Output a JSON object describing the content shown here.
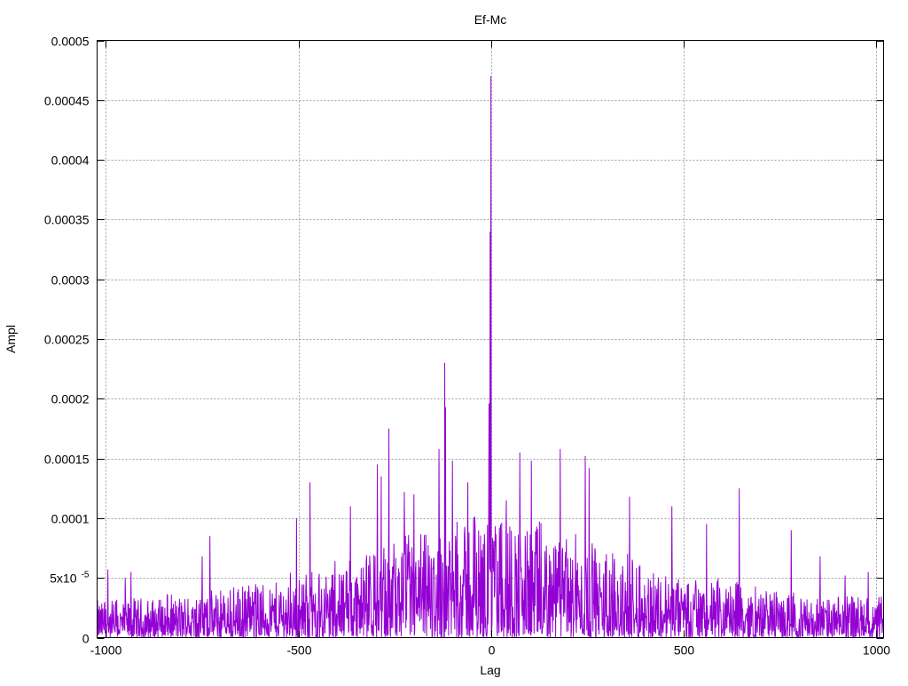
{
  "chart_data": {
    "type": "line",
    "title": "Ef-Mc",
    "xlabel": "Lag",
    "ylabel": "Ampl",
    "xlim": [
      -1023,
      1020
    ],
    "ylim": [
      0,
      0.0005
    ],
    "grid": true,
    "line_color": "#9400d3",
    "x_ticks": [
      {
        "value": -1000,
        "label": "-1000"
      },
      {
        "value": -500,
        "label": "-500"
      },
      {
        "value": 0,
        "label": "0"
      },
      {
        "value": 500,
        "label": "500"
      },
      {
        "value": 1000,
        "label": "1000"
      }
    ],
    "y_ticks": [
      {
        "value": 0,
        "label": "0"
      },
      {
        "value": 5e-05,
        "label": "5x10",
        "sup": "-5"
      },
      {
        "value": 0.0001,
        "label": "0.0001"
      },
      {
        "value": 0.00015,
        "label": "0.00015"
      },
      {
        "value": 0.0002,
        "label": "0.0002"
      },
      {
        "value": 0.00025,
        "label": "0.00025"
      },
      {
        "value": 0.0003,
        "label": "0.0003"
      },
      {
        "value": 0.00035,
        "label": "0.00035"
      },
      {
        "value": 0.0004,
        "label": "0.0004"
      },
      {
        "value": 0.00045,
        "label": "0.00045"
      },
      {
        "value": 0.0005,
        "label": "0.0005"
      }
    ],
    "series": [
      {
        "name": "Ef-Mc",
        "envelope": {
          "center_max": 0.000105,
          "edge_max": 3e-05
        },
        "peaks": [
          [
            0,
            0.00047
          ],
          [
            -2,
            0.00034
          ],
          [
            -5,
            0.000196
          ],
          [
            -120,
            0.00023
          ],
          [
            -118,
            0.000193
          ],
          [
            -265,
            0.000175
          ],
          [
            -135,
            0.000158
          ],
          [
            -295,
            0.000145
          ],
          [
            -470,
            0.00013
          ],
          [
            -285,
            0.000135
          ],
          [
            -225,
            0.000122
          ],
          [
            75,
            0.000155
          ],
          [
            105,
            0.000148
          ],
          [
            180,
            0.000158
          ],
          [
            245,
            0.000152
          ],
          [
            255,
            0.000142
          ],
          [
            645,
            0.000125
          ],
          [
            -100,
            0.000148
          ],
          [
            -60,
            0.00013
          ],
          [
            360,
            0.000118
          ],
          [
            -365,
            0.00011
          ],
          [
            -505,
            0.0001
          ],
          [
            -730,
            8.5e-05
          ],
          [
            -950,
            5e-05
          ],
          [
            -995,
            5.7e-05
          ],
          [
            -935,
            5.5e-05
          ],
          [
            -750,
            6.8e-05
          ],
          [
            920,
            5.2e-05
          ],
          [
            980,
            5.5e-05
          ],
          [
            855,
            6.8e-05
          ],
          [
            780,
            9e-05
          ],
          [
            560,
            9.5e-05
          ],
          [
            470,
            0.00011
          ],
          [
            -200,
            0.00012
          ],
          [
            40,
            0.000115
          ]
        ]
      }
    ]
  }
}
